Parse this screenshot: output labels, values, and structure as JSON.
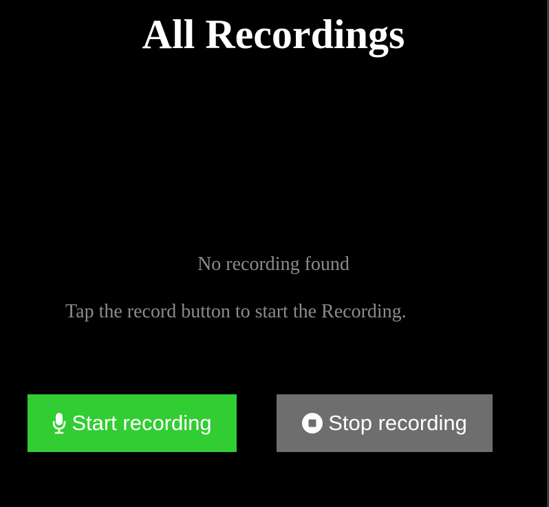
{
  "header": {
    "title": "All Recordings"
  },
  "empty_state": {
    "heading": "No recording found",
    "hint": "Tap the record button to start the Recording."
  },
  "controls": {
    "start": {
      "label": "Start recording",
      "icon": "microphone-icon",
      "color": "#32cd32"
    },
    "stop": {
      "label": "Stop recording",
      "icon": "stop-circle-icon",
      "color": "#6e6e6e"
    }
  },
  "theme": {
    "background": "#000000",
    "title_color": "#ffffff",
    "muted_text": "#8c8c8c"
  }
}
